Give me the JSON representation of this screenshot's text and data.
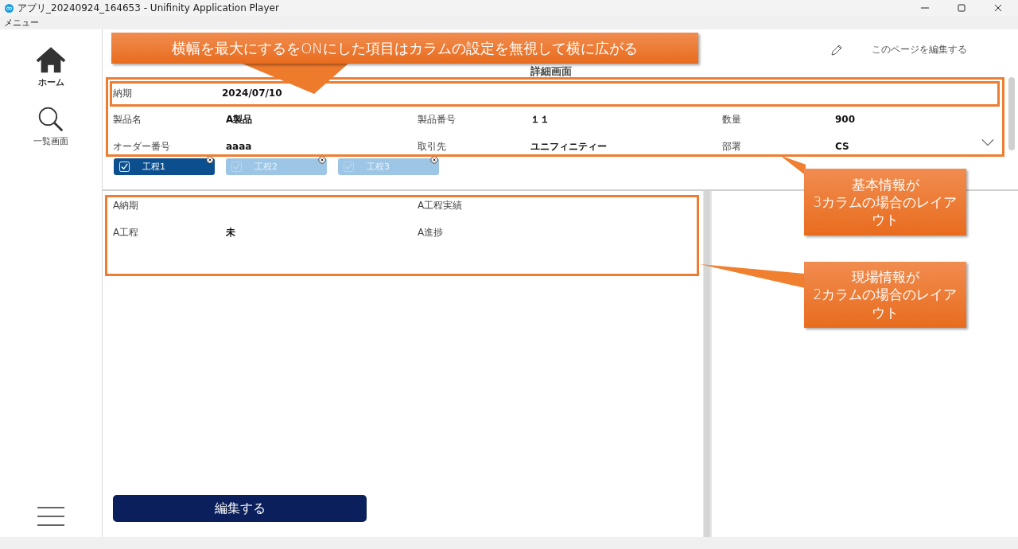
{
  "window": {
    "title": "アプリ_20240924_164653 - Unifinity Application Player",
    "menu": "メニュー"
  },
  "sidebar": {
    "items": [
      {
        "label": "ホーム",
        "kind": "home",
        "selected": true
      },
      {
        "label": "一覧画面",
        "kind": "search",
        "selected": false
      }
    ]
  },
  "page": {
    "title": "詳細画面",
    "edit_link": "このページを編集する"
  },
  "basic_info": {
    "full_rows": [
      {
        "label": "納期",
        "value": "2024/07/10"
      }
    ],
    "fields": [
      {
        "label": "製品名",
        "value": "A製品"
      },
      {
        "label": "製品番号",
        "value": "１１"
      },
      {
        "label": "数量",
        "value": "900"
      },
      {
        "label": "オーダー番号",
        "value": "aaaa"
      },
      {
        "label": "取引先",
        "value": "ユニフィニティー"
      },
      {
        "label": "部署",
        "value": "CS"
      }
    ]
  },
  "processes": [
    {
      "label": "工程1",
      "selected": true
    },
    {
      "label": "工程2",
      "selected": false
    },
    {
      "label": "工程3",
      "selected": false
    }
  ],
  "site_info": {
    "fields": [
      {
        "label": "A納期"
      },
      {
        "label": "A工程実績"
      },
      {
        "label": "A工程",
        "value": "未"
      },
      {
        "label": "A進捗"
      }
    ]
  },
  "edit_button": "編集する",
  "annotations": [
    {
      "lines": [
        "横幅を最大にするをONにした項目はカラムの設定を無視して横に広がる"
      ]
    },
    {
      "lines": [
        "基本情報が",
        "3カラムの場合のレイアウト"
      ]
    },
    {
      "lines": [
        "現場情報が",
        "2カラムの場合のレイアウト"
      ]
    }
  ]
}
